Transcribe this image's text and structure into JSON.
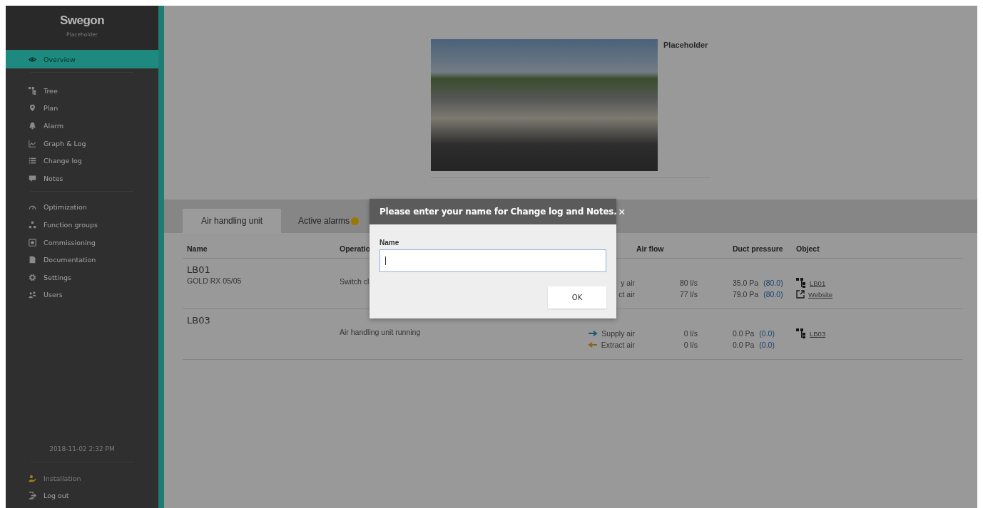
{
  "sidebar": {
    "logo": "Swegon",
    "subtitle": "Placeholder",
    "groups": [
      {
        "items": [
          {
            "label": "Overview",
            "selected": true
          }
        ]
      },
      {
        "items": [
          {
            "label": "Tree",
            "selected": false
          },
          {
            "label": "Plan",
            "selected": false
          },
          {
            "label": "Alarm",
            "selected": false
          },
          {
            "label": "Graph & Log",
            "selected": false
          },
          {
            "label": "Change log",
            "selected": false
          },
          {
            "label": "Notes",
            "selected": false
          }
        ]
      },
      {
        "items": [
          {
            "label": "Optimization",
            "selected": false
          },
          {
            "label": "Function groups",
            "selected": false
          },
          {
            "label": "Commissioning",
            "selected": false
          },
          {
            "label": "Documentation",
            "selected": false
          },
          {
            "label": "Settings",
            "selected": false
          },
          {
            "label": "Users",
            "selected": false
          }
        ]
      }
    ],
    "timestamp": "2018-11-02 2:32 PM",
    "footer": [
      {
        "label": "Installation",
        "disabled": true
      },
      {
        "label": "Log out",
        "disabled": false
      }
    ]
  },
  "overview": {
    "caption": "Placeholder"
  },
  "tabs": [
    {
      "label": "Air handling unit",
      "selected": true
    },
    {
      "label": "Active alarms",
      "selected": false
    }
  ],
  "table": {
    "header": {
      "name": "Name",
      "operation": "Operatio",
      "air_flow": "Air flow",
      "duct_pressure": "Duct pressure",
      "object": "Object"
    },
    "rows": [
      {
        "name": "LB01",
        "model": "GOLD RX 05/05",
        "operation": "Switch cl",
        "flows": [
          {
            "label": "y air",
            "flow": "80 l/s",
            "pressure": "35.0 Pa",
            "setpoint": "(80.0)"
          },
          {
            "label": "ct air",
            "flow": "77 l/s",
            "pressure": "79.0 Pa",
            "setpoint": "(80.0)"
          }
        ],
        "links": [
          {
            "kind": "tree",
            "label": "LB01"
          },
          {
            "kind": "external",
            "label": "Website"
          }
        ]
      },
      {
        "name": "LB03",
        "operation": "Air handling unit running",
        "flows": [
          {
            "kind": "supply",
            "label": "Supply air",
            "flow": "0 l/s",
            "pressure": "0.0 Pa",
            "setpoint": "(0.0)"
          },
          {
            "kind": "extract",
            "label": "Extract air",
            "flow": "0 l/s",
            "pressure": "0.0 Pa",
            "setpoint": "(0.0)"
          }
        ],
        "links": [
          {
            "kind": "tree",
            "label": "LB03"
          }
        ]
      }
    ]
  },
  "dialog": {
    "title": "Please enter your name for Change log and Notes.",
    "close": "×",
    "field_label": "Name",
    "button": "OK"
  }
}
